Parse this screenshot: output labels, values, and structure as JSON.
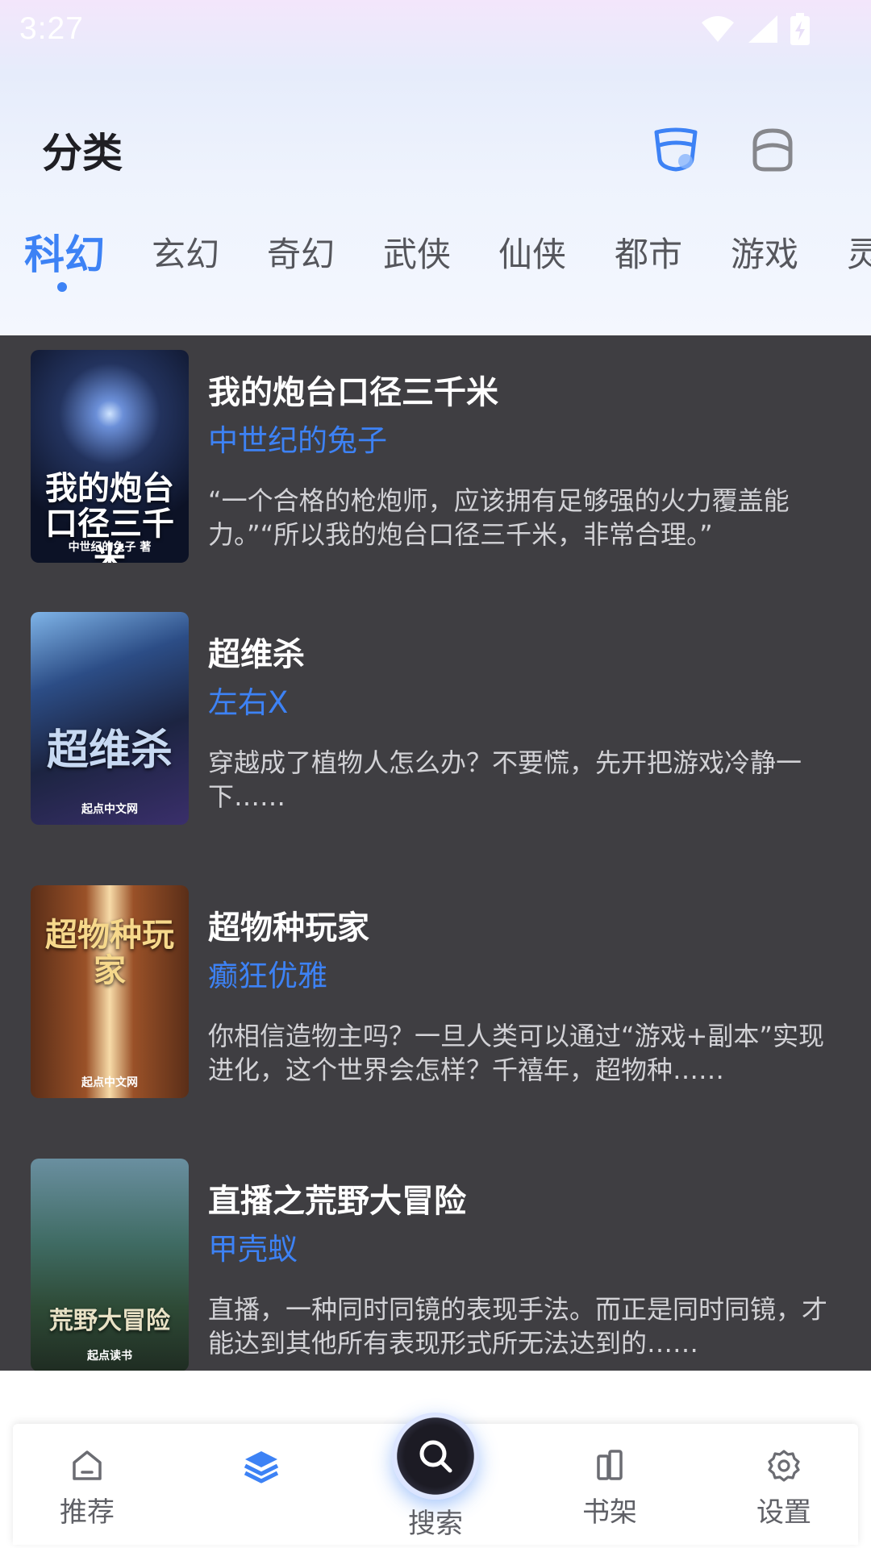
{
  "status_bar": {
    "time": "3:27"
  },
  "header": {
    "title": "分类"
  },
  "tabs": [
    {
      "label": "科幻"
    },
    {
      "label": "玄幻"
    },
    {
      "label": "奇幻"
    },
    {
      "label": "武侠"
    },
    {
      "label": "仙侠"
    },
    {
      "label": "都市"
    },
    {
      "label": "游戏"
    },
    {
      "label": "灵"
    }
  ],
  "books": [
    {
      "title": "我的炮台口径三千米",
      "author": "中世纪的兔子",
      "desc": "“一个合格的枪炮师，应该拥有足够强的火力覆盖能力。”“所以我的炮台口径三千米，非常合理。”",
      "cover_text": "我的炮台口径三千米",
      "cover_publisher": "中世纪的兔子 著"
    },
    {
      "title": "超维杀",
      "author": "左右X",
      "desc": "穿越成了植物人怎么办？不要慌，先开把游戏冷静一下……",
      "cover_text": "超维杀",
      "cover_publisher": "起点中文网"
    },
    {
      "title": "超物种玩家",
      "author": "癫狂优雅",
      "desc": "你相信造物主吗？一旦人类可以通过“游戏+副本”实现进化，这个世界会怎样？千禧年，超物种……",
      "cover_text": "超物种玩家",
      "cover_publisher": "起点中文网"
    },
    {
      "title": "直播之荒野大冒险",
      "author": "甲壳蚁",
      "desc": "直播，一种同时同镜的表现手法。而正是同时同镜，才能达到其他所有表现形式所无法达到的……",
      "cover_text": "荒野大冒险",
      "cover_publisher": "起点读书"
    }
  ],
  "bottom_nav": {
    "items": [
      {
        "label": "推荐",
        "icon": "home-icon"
      },
      {
        "label": "",
        "icon": "layers-icon"
      },
      {
        "label": "搜索",
        "icon": "search-icon"
      },
      {
        "label": "书架",
        "icon": "bookshelf-icon"
      },
      {
        "label": "设置",
        "icon": "gear-icon"
      }
    ]
  },
  "colors": {
    "accent": "#3d82f5",
    "list_bg": "#3f3e42",
    "title_text": "#1f1f24"
  }
}
